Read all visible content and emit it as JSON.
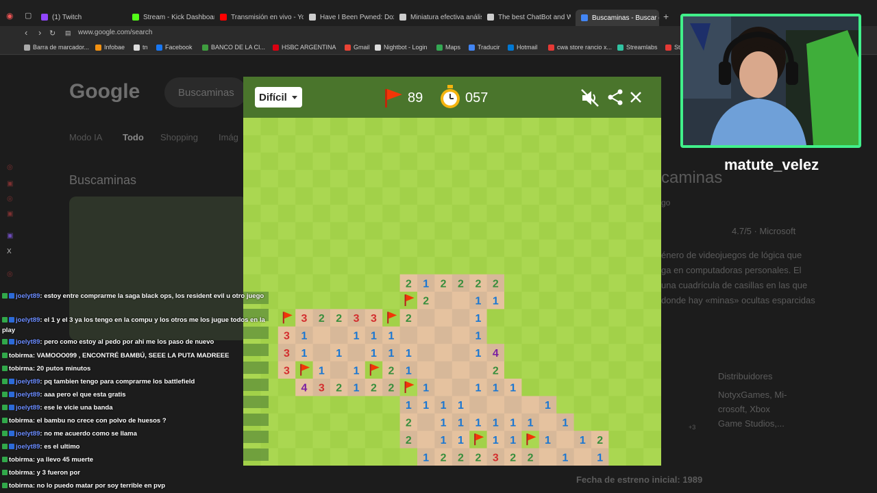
{
  "browser": {
    "tabs": [
      {
        "label": "(1) Twitch",
        "color": "#9146ff"
      },
      {
        "label": "Stream - Kick Dashboard",
        "color": "#53fc18"
      },
      {
        "label": "Transmisión en vivo - You",
        "color": "#ff0000"
      },
      {
        "label": "Have I Been Pwned: Doxb",
        "color": "#cccccc"
      },
      {
        "label": "Miniatura efectiva análisis",
        "color": "#cccccc"
      },
      {
        "label": "The best ChatBot and Wi",
        "color": "#cccccc"
      },
      {
        "label": "Buscaminas - Buscar con",
        "color": "#4285f4",
        "active": true
      }
    ],
    "url": "www.google.com/search",
    "bookmarks": [
      {
        "label": "Barra de marcador...",
        "color": "#aaaaaa"
      },
      {
        "label": "Infobae",
        "color": "#f29111"
      },
      {
        "label": "tn",
        "color": "#dddddd"
      },
      {
        "label": "Facebook",
        "color": "#1877f2"
      },
      {
        "label": "BANCO DE LA CI...",
        "color": "#3f9d3f"
      },
      {
        "label": "HSBC ARGENTINA",
        "color": "#db0011"
      },
      {
        "label": "Gmail",
        "color": "#ea4335"
      },
      {
        "label": "Nightbot - Login",
        "color": "#dddddd"
      },
      {
        "label": "Maps",
        "color": "#34a853"
      },
      {
        "label": "Traducir",
        "color": "#4285f4"
      },
      {
        "label": "Hotmail",
        "color": "#0078d4"
      },
      {
        "label": "cwa store rancio x...",
        "color": "#e53935"
      },
      {
        "label": "Streamlabs",
        "color": "#31c3a2"
      },
      {
        "label": "St",
        "color": "#e53935"
      }
    ]
  },
  "google": {
    "logo": "Google",
    "query": "Buscaminas",
    "tabs": [
      "Modo IA",
      "Todo",
      "Shopping",
      "Imág"
    ],
    "heading": "Buscaminas",
    "side_title": "caminas",
    "side_sub": "go",
    "rating": "4.7/5 · Microsoft",
    "description": [
      "énero de videojuegos de lógica que",
      "ga en computadoras personales. El",
      "una cuadrícula de casillas en las que",
      "donde hay «minas» ocultas esparcidas"
    ],
    "distributors_label": "Distribuidores",
    "distributors_text": [
      "NotyxGames, Mi-",
      "crosoft, Xbox",
      "Game Studios,..."
    ],
    "release": "Fecha de estreno inicial: 1989",
    "plus3": "+3"
  },
  "game": {
    "difficulty": "Difícil",
    "flags_left": "89",
    "timer": "057",
    "colors": {
      "header": "#4a752c",
      "light": "#aad751",
      "dark": "#a2d149",
      "revealed_light": "#e5c29f",
      "revealed_dark": "#d7b899",
      "flag": "#f23607"
    },
    "rows": [
      "........................",
      "........................",
      "........................",
      "........................",
      "........................",
      "........................",
      "........................",
      "........................",
      "........................",
      "...........2/1/1/2/2/2....",
      "...........F2___11.......",
      "..F3222 3F2_____1.......",
      "..31__111_______1.......",
      "..31_1_111_____14.......",
      "..3F1_1F21____2........",
      "...432122F1___111......",
      ".........1111______1......",
      ".........2_111111_1......",
      ".........2_11F11F1_12....",
      "..........1222322 1_1....",
      "............1F2F1___1...."
    ],
    "grid": [
      "..........................",
      "..........................",
      "..........................",
      "..........................",
      "..........................",
      "..........................",
      "..........................",
      "..........................",
      "..........................",
      ".........212222...........",
      ".........F2__11...........",
      "..F32233F2___1............",
      "..31__111____1............",
      "..31_1_111___14...........",
      "..3F1_1F21____2...........",
      "...432122F1__111..........",
      ".........1111____1.........",
      ".........2_111111_1.......",
      ".........2_11F11F1_12.....",
      "..........1222322_1_1.....",
      "...........1F2F1____1....."
    ]
  },
  "chat": [
    {
      "user": "joelyt89",
      "utype": 1,
      "text": ": estoy entre comprarme la saga black ops, los resident evil u otro juego"
    },
    {
      "user": "joelyt89",
      "utype": 1,
      "text": ": el 1 y el 3 ya los tengo en la compu y los otros me los jugue todos en la play"
    },
    {
      "user": "joelyt89",
      "utype": 1,
      "text": ": pero como estoy al pedo por ahi me los paso de nuevo"
    },
    {
      "user": "tobirma",
      "utype": 2,
      "text": ": VAMOOO099 , ENCONTRÉ BAMBÚ, SEEE LA PUTA MADREEE"
    },
    {
      "user": "tobirma",
      "utype": 2,
      "text": ": 20 putos minutos"
    },
    {
      "user": "joelyt89",
      "utype": 1,
      "text": ": pq tambien tengo para comprarme los battlefield"
    },
    {
      "user": "joelyt89",
      "utype": 1,
      "text": ": aaa pero el que esta gratis"
    },
    {
      "user": "joelyt89",
      "utype": 1,
      "text": ": ese le vicie una banda"
    },
    {
      "user": "tobirma",
      "utype": 2,
      "text": ": el bambu no crece con polvo de huesos ?"
    },
    {
      "user": "joelyt89",
      "utype": 1,
      "text": ": no me acuerdo como se llama"
    },
    {
      "user": "joelyt89",
      "utype": 1,
      "text": ": es el ultimo"
    },
    {
      "user": "tobirma",
      "utype": 2,
      "text": ": ya llevo 45 muerte"
    },
    {
      "user": "tobirma",
      "utype": 2,
      "text": ": y 3 fueron por"
    },
    {
      "user": "tobirma",
      "utype": 2,
      "text": ": no lo puedo matar por soy terrible en pvp"
    }
  ],
  "streamer": "matute_velez"
}
